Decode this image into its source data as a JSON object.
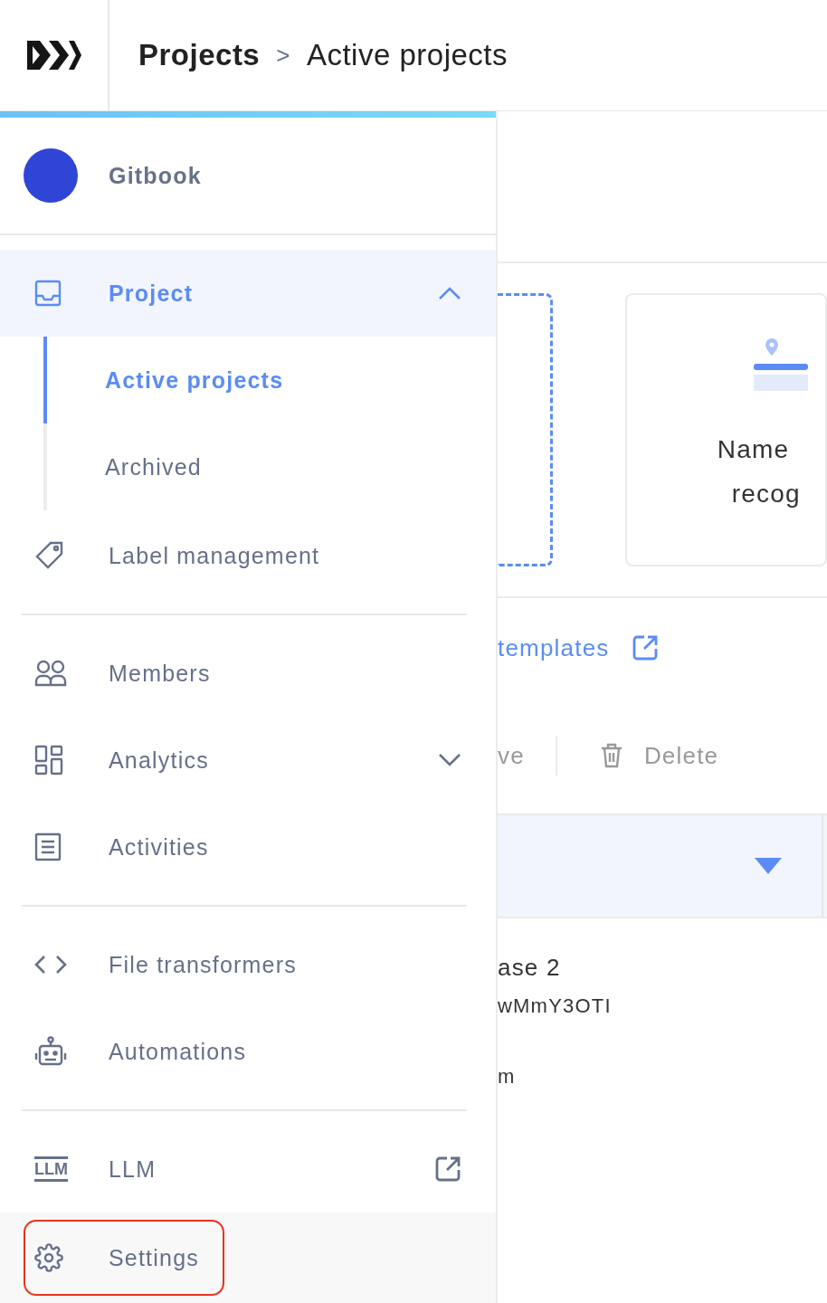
{
  "header": {
    "breadcrumb": [
      {
        "label": "Projects",
        "current": false
      },
      {
        "label": "Active projects",
        "current": true
      }
    ],
    "separator": ">"
  },
  "sidebar": {
    "workspace": {
      "name": "Gitbook"
    },
    "sections": [
      [
        {
          "label": "Project",
          "active": true,
          "expanded": true,
          "children": [
            {
              "label": "Active projects",
              "selected": true
            },
            {
              "label": "Archived",
              "selected": false
            }
          ]
        },
        {
          "label": "Label management"
        }
      ],
      [
        {
          "label": "Members"
        },
        {
          "label": "Analytics",
          "expanded": false
        },
        {
          "label": "Activities"
        }
      ],
      [
        {
          "label": "File transformers"
        },
        {
          "label": "Automations"
        }
      ],
      [
        {
          "label": "LLM",
          "icon_text": "LLM",
          "external": true
        },
        {
          "label": "Settings",
          "highlighted": true
        }
      ]
    ]
  },
  "content": {
    "cards": [
      {
        "title_line_1": "Name",
        "title_line_2": "recog"
      }
    ],
    "templates_link": "templates",
    "toolbar": [
      {
        "label": "ve",
        "kind": "text"
      },
      {
        "label": "Delete",
        "kind": "delete"
      }
    ],
    "table": {
      "rows": [
        {
          "text": "ase 2",
          "kind": "title"
        },
        {
          "text": "wMmY3OTI",
          "kind": "id"
        },
        {
          "text": "m",
          "kind": "meta"
        }
      ]
    }
  }
}
